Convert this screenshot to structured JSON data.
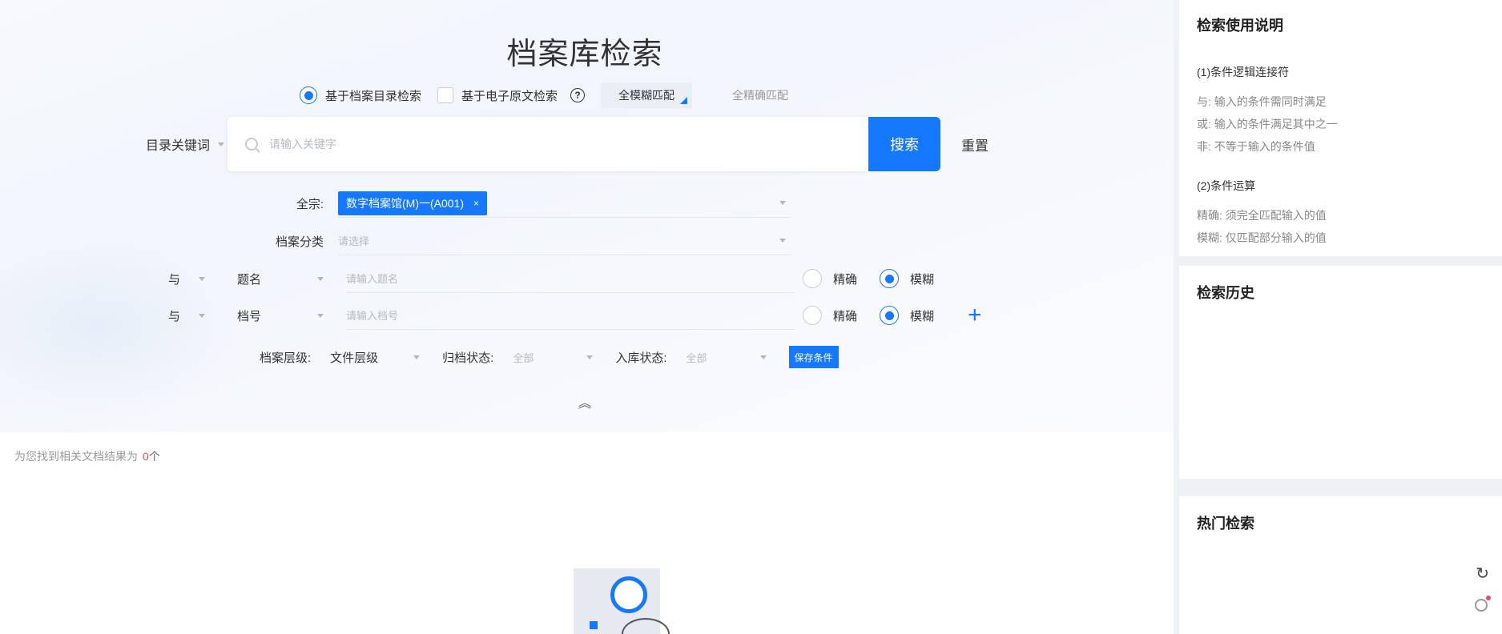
{
  "page": {
    "title": "档案库检索"
  },
  "mode": {
    "catalog_label": "基于档案目录检索",
    "catalog_selected": true,
    "fulltext_label": "基于电子原文检索",
    "fulltext_checked": false,
    "match_button": "全模糊匹配",
    "match_alt": "全精确匹配"
  },
  "keyword": {
    "field_label": "目录关键词",
    "placeholder": "请输入关键字",
    "search_button": "搜索",
    "reset_button": "重置"
  },
  "fonds": {
    "label": "全宗:",
    "tag": "数字档案馆(M)一(A001)",
    "tag_close": "×"
  },
  "category": {
    "label": "档案分类",
    "placeholder": "请选择"
  },
  "conditions": [
    {
      "logic": "与",
      "field": "题名",
      "placeholder": "请输入题名",
      "exact_label": "精确",
      "fuzzy_label": "模糊",
      "mode": "fuzzy"
    },
    {
      "logic": "与",
      "field": "档号",
      "placeholder": "请输入档号",
      "exact_label": "精确",
      "fuzzy_label": "模糊",
      "mode": "fuzzy"
    }
  ],
  "filters": {
    "level_label": "档案层级:",
    "level_value": "文件层级",
    "archive_label": "归档状态:",
    "archive_value": "全部",
    "storage_label": "入库状态:",
    "storage_value": "全部",
    "save_button": "保存条件"
  },
  "result": {
    "prefix": "为您找到相关文档结果为",
    "count": "0",
    "unit": "个"
  },
  "sidebar": {
    "help": {
      "title": "检索使用说明",
      "section1": "(1)条件逻辑连接符",
      "lines1": [
        "与: 输入的条件需同时满足",
        "或: 输入的条件满足其中之一",
        "非: 不等于输入的条件值"
      ],
      "section2": "(2)条件运算",
      "lines2": [
        "精确: 须完全匹配输入的值",
        "模糊: 仅匹配部分输入的值"
      ]
    },
    "history": {
      "title": "检索历史"
    },
    "hot": {
      "title": "热门检索"
    }
  },
  "icons": {
    "help": "question-circle-icon",
    "plus": "plus-icon",
    "collapse": "double-chevron-up-icon",
    "refresh": "refresh-icon",
    "search": "search-icon"
  },
  "colors": {
    "accent": "#1677ff",
    "count": "#e9495b"
  }
}
